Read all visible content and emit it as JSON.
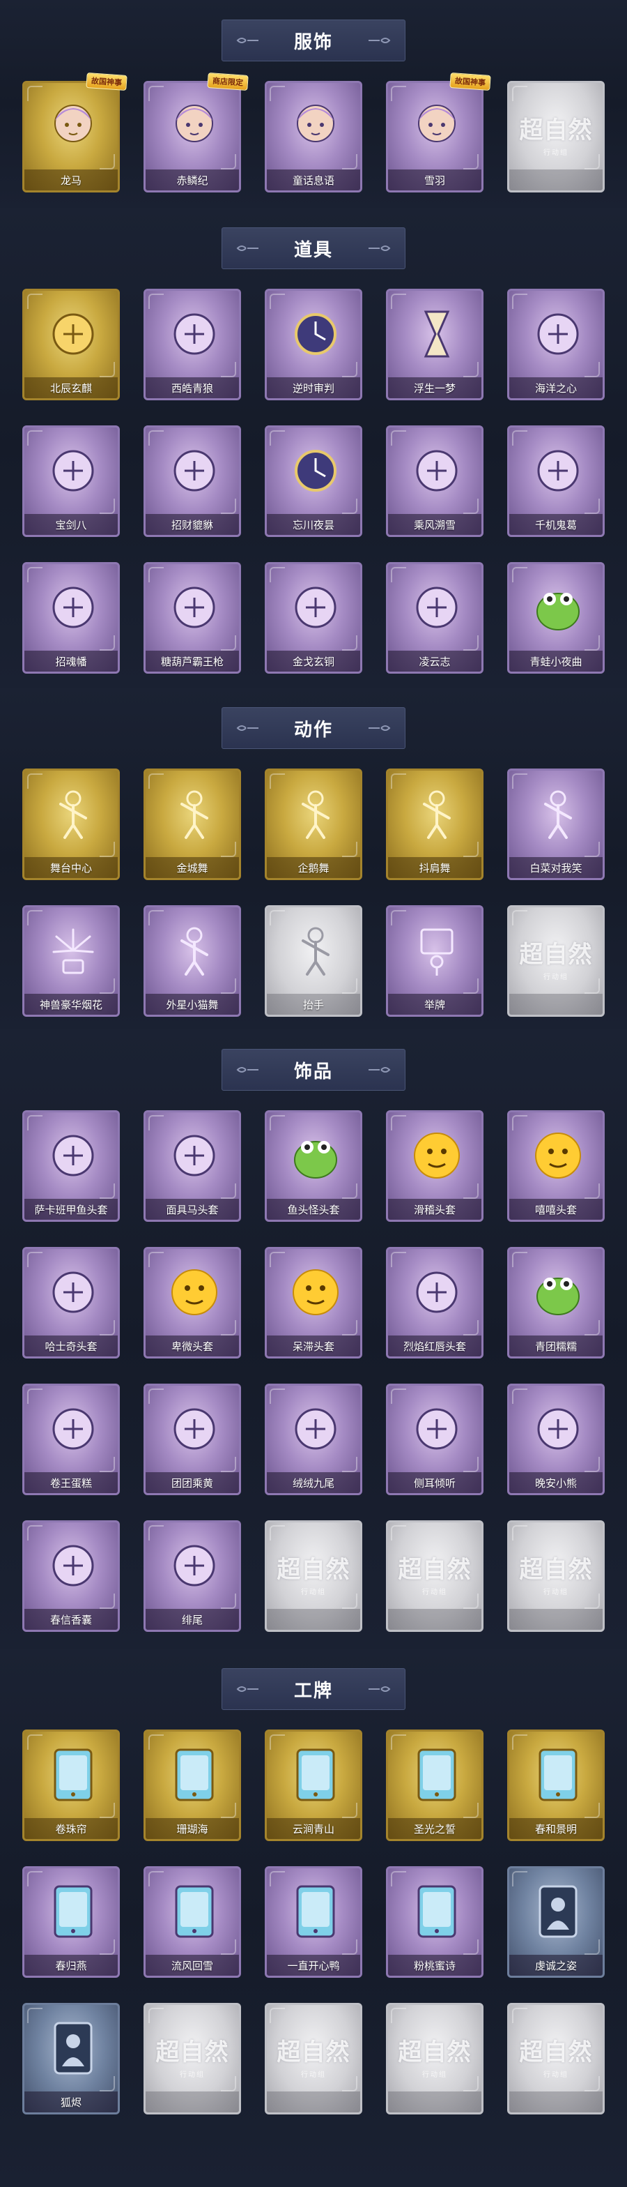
{
  "colors": {
    "background": "#161c2b",
    "title_bar": "#2f3754",
    "gold_frame": "#c9a940",
    "purple_frame": "#a58bc4",
    "silver_frame": "#d2d2d6",
    "slate_frame": "#7083a1"
  },
  "placeholder": {
    "logo": "超自然",
    "sub": "行动组"
  },
  "sections": [
    {
      "title": "服饰",
      "items": [
        {
          "label": "龙马",
          "rarity": "gold",
          "icon": "character-portrait-icon",
          "badge": "故国神事"
        },
        {
          "label": "赤鳞纪",
          "rarity": "purple",
          "icon": "character-portrait-icon",
          "badge": "商店限定"
        },
        {
          "label": "童话息语",
          "rarity": "purple",
          "icon": "character-portrait-icon"
        },
        {
          "label": "雪羽",
          "rarity": "purple",
          "icon": "character-portrait-icon",
          "badge": "故国神事"
        },
        {
          "label": "",
          "rarity": "silver",
          "icon": "placeholder-logo"
        }
      ]
    },
    {
      "title": "道具",
      "items": [
        {
          "label": "北辰玄麒",
          "rarity": "gold",
          "icon": "golden-beast-icon"
        },
        {
          "label": "西皓青狼",
          "rarity": "purple",
          "icon": "wolf-staff-icon"
        },
        {
          "label": "逆时审判",
          "rarity": "purple",
          "icon": "clock-orb-icon"
        },
        {
          "label": "浮生一梦",
          "rarity": "purple",
          "icon": "hourglass-icon"
        },
        {
          "label": "海洋之心",
          "rarity": "purple",
          "icon": "pendant-necklace-icon"
        },
        {
          "label": "宝剑八",
          "rarity": "purple",
          "icon": "heart-mirror-icon"
        },
        {
          "label": "招财貔貅",
          "rarity": "purple",
          "icon": "pixiu-beast-icon"
        },
        {
          "label": "忘川夜昙",
          "rarity": "purple",
          "icon": "lotus-crystal-icon"
        },
        {
          "label": "乘风溯雪",
          "rarity": "purple",
          "icon": "jet-boots-icon"
        },
        {
          "label": "千机鬼葛",
          "rarity": "purple",
          "icon": "spear-icon"
        },
        {
          "label": "招魂幡",
          "rarity": "purple",
          "icon": "banner-flag-icon"
        },
        {
          "label": "糖葫芦霸王枪",
          "rarity": "purple",
          "icon": "candied-spear-icon"
        },
        {
          "label": "金戈玄铜",
          "rarity": "purple",
          "icon": "lantern-icon"
        },
        {
          "label": "凌云志",
          "rarity": "purple",
          "icon": "ribbon-icon"
        },
        {
          "label": "青蛙小夜曲",
          "rarity": "purple",
          "icon": "frog-icon"
        }
      ]
    },
    {
      "title": "动作",
      "items": [
        {
          "label": "舞台中心",
          "rarity": "gold",
          "icon": "pose-figure-icon"
        },
        {
          "label": "金城舞",
          "rarity": "gold",
          "icon": "pose-figure-icon"
        },
        {
          "label": "企鹅舞",
          "rarity": "gold",
          "icon": "pose-figure-icon"
        },
        {
          "label": "抖肩舞",
          "rarity": "gold",
          "icon": "pose-figure-icon"
        },
        {
          "label": "白菜对我笑",
          "rarity": "purple",
          "icon": "pose-figure-icon"
        },
        {
          "label": "神兽豪华烟花",
          "rarity": "purple",
          "icon": "fireworks-icon"
        },
        {
          "label": "外星小猫舞",
          "rarity": "purple",
          "icon": "pose-figure-icon"
        },
        {
          "label": "抬手",
          "rarity": "silver",
          "icon": "pose-figure-icon"
        },
        {
          "label": "举牌",
          "rarity": "purple",
          "icon": "sign-holder-icon"
        },
        {
          "label": "",
          "rarity": "silver",
          "icon": "placeholder-logo"
        }
      ]
    },
    {
      "title": "饰品",
      "items": [
        {
          "label": "萨卡班甲鱼头套",
          "rarity": "purple",
          "icon": "fish-mask-icon"
        },
        {
          "label": "面具马头套",
          "rarity": "purple",
          "icon": "horse-mask-icon"
        },
        {
          "label": "鱼头怪头套",
          "rarity": "purple",
          "icon": "fishman-mask-icon"
        },
        {
          "label": "滑稽头套",
          "rarity": "purple",
          "icon": "smirk-emoji-icon"
        },
        {
          "label": "嘻嘻头套",
          "rarity": "purple",
          "icon": "grin-emoji-icon"
        },
        {
          "label": "哈士奇头套",
          "rarity": "purple",
          "icon": "husky-mask-icon"
        },
        {
          "label": "卑微头套",
          "rarity": "purple",
          "icon": "shy-emoji-icon"
        },
        {
          "label": "呆滞头套",
          "rarity": "purple",
          "icon": "dazed-emoji-icon"
        },
        {
          "label": "烈焰红唇头套",
          "rarity": "purple",
          "icon": "pikachu-mask-icon"
        },
        {
          "label": "青团糯糯",
          "rarity": "purple",
          "icon": "green-bun-icon"
        },
        {
          "label": "卷王蛋糕",
          "rarity": "purple",
          "icon": "roll-cake-icon"
        },
        {
          "label": "团团乘黄",
          "rarity": "purple",
          "icon": "cat-bun-icon"
        },
        {
          "label": "绒绒九尾",
          "rarity": "purple",
          "icon": "fox-plush-icon"
        },
        {
          "label": "侧耳倾听",
          "rarity": "purple",
          "icon": "lotus-charm-icon"
        },
        {
          "label": "晚安小熊",
          "rarity": "purple",
          "icon": "bear-charm-icon"
        },
        {
          "label": "春信香囊",
          "rarity": "purple",
          "icon": "sachet-icon"
        },
        {
          "label": "绯尾",
          "rarity": "purple",
          "icon": "fox-tail-charm-icon"
        },
        {
          "label": "",
          "rarity": "silver",
          "icon": "placeholder-logo"
        },
        {
          "label": "",
          "rarity": "silver",
          "icon": "placeholder-logo"
        },
        {
          "label": "",
          "rarity": "silver",
          "icon": "placeholder-logo"
        }
      ]
    },
    {
      "title": "工牌",
      "items": [
        {
          "label": "卷珠帘",
          "rarity": "gold",
          "icon": "badge-card-icon"
        },
        {
          "label": "珊瑚海",
          "rarity": "gold",
          "icon": "badge-card-icon"
        },
        {
          "label": "云涧青山",
          "rarity": "gold",
          "icon": "badge-card-icon"
        },
        {
          "label": "圣光之誓",
          "rarity": "gold",
          "icon": "badge-card-icon"
        },
        {
          "label": "春和景明",
          "rarity": "gold",
          "icon": "badge-card-icon"
        },
        {
          "label": "春归燕",
          "rarity": "purple",
          "icon": "badge-card-icon"
        },
        {
          "label": "流风回雪",
          "rarity": "purple",
          "icon": "badge-card-icon"
        },
        {
          "label": "一直开心鸭",
          "rarity": "purple",
          "icon": "badge-card-icon"
        },
        {
          "label": "粉桃蜜诗",
          "rarity": "purple",
          "icon": "badge-card-icon"
        },
        {
          "label": "虔诚之姿",
          "rarity": "slate",
          "icon": "silhouette-card-icon"
        },
        {
          "label": "狐烬",
          "rarity": "slate",
          "icon": "silhouette-card-icon"
        },
        {
          "label": "",
          "rarity": "silver",
          "icon": "placeholder-logo"
        },
        {
          "label": "",
          "rarity": "silver",
          "icon": "placeholder-logo"
        },
        {
          "label": "",
          "rarity": "silver",
          "icon": "placeholder-logo"
        },
        {
          "label": "",
          "rarity": "silver",
          "icon": "placeholder-logo"
        }
      ]
    }
  ]
}
